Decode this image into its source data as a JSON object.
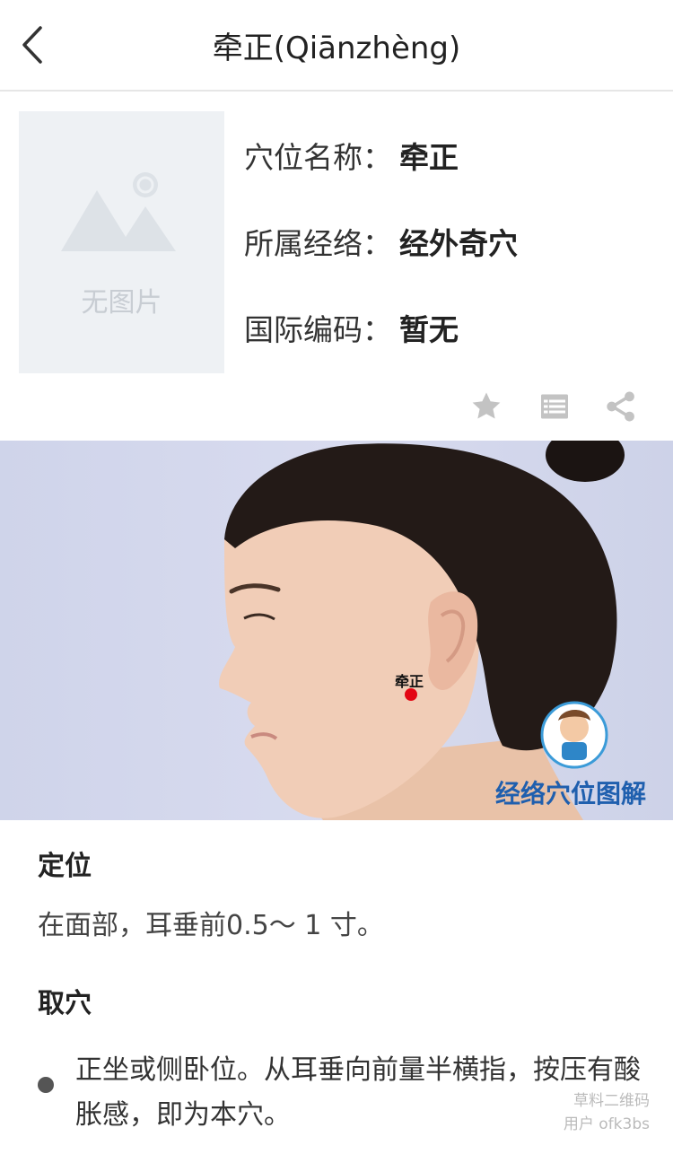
{
  "nav": {
    "title": "牵正(Qiānzhèng)",
    "back_icon": "chevron-left-icon"
  },
  "thumbnail": {
    "no_image_label": "无图片",
    "icon": "image-placeholder-icon"
  },
  "info": [
    {
      "key": "穴位名称：",
      "value": "牵正"
    },
    {
      "key": "所属经络：",
      "value": "经外奇穴"
    },
    {
      "key": "国际编码：",
      "value": "暂无"
    }
  ],
  "actions": {
    "favorite_icon": "star-icon",
    "list_icon": "list-icon",
    "share_icon": "share-icon"
  },
  "photo": {
    "point_label": "牵正",
    "brand_text": "经络穴位图解",
    "point_color": "#e30613"
  },
  "location": {
    "heading": "定位",
    "text": "在面部，耳垂前0.5～ 1 寸。"
  },
  "method": {
    "heading": "取穴",
    "text": "正坐或侧卧位。从耳垂向前量半横指，按压有酸胀感，即为本穴。"
  },
  "watermark": {
    "line1": "草料二维码",
    "line2": "用户 ofk3bs"
  }
}
